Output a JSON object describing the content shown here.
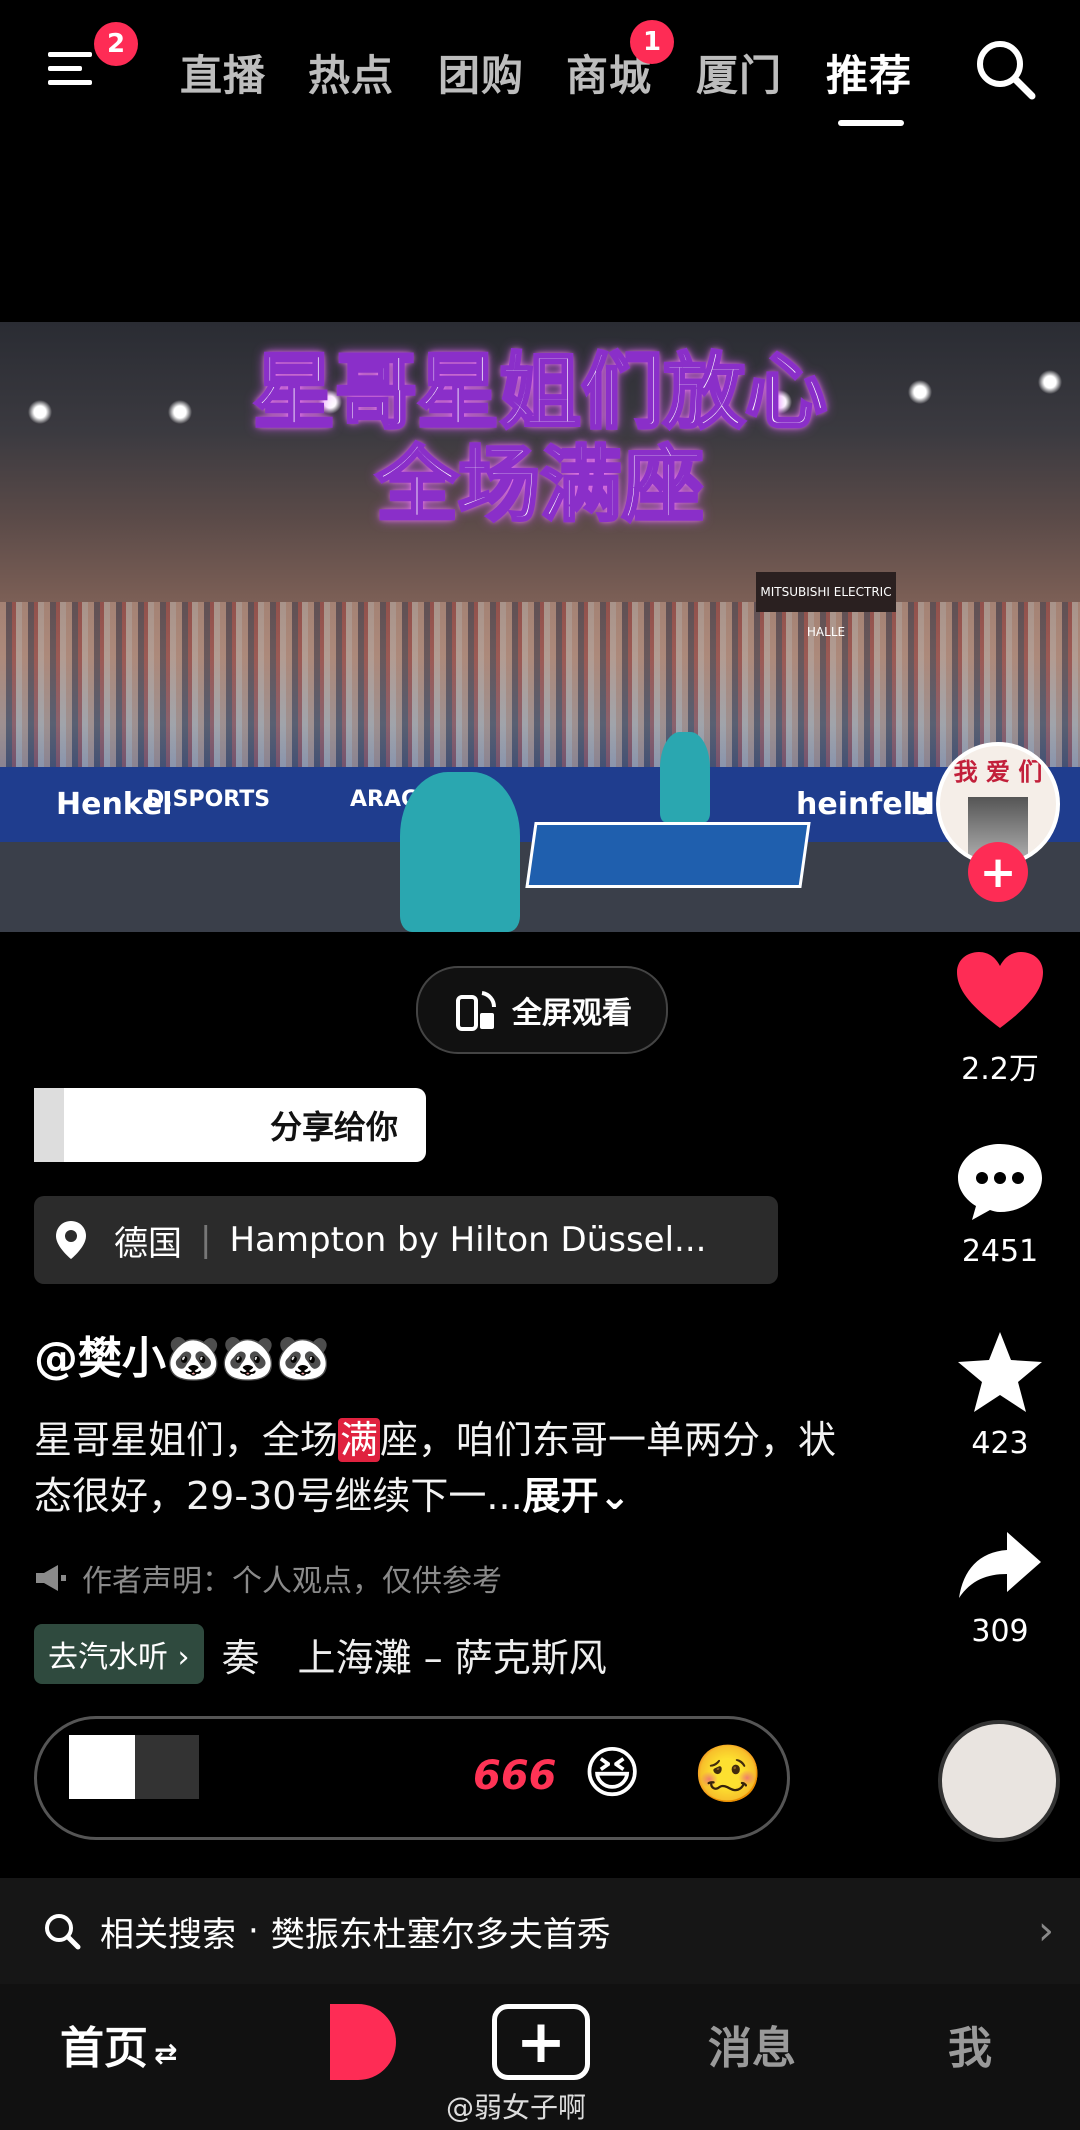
{
  "top_nav": {
    "menu_badge": "2",
    "tabs": [
      {
        "label": "直播"
      },
      {
        "label": "热点"
      },
      {
        "label": "团购"
      },
      {
        "label": "商城",
        "badge": "1"
      },
      {
        "label": "厦门"
      },
      {
        "label": "推荐",
        "active": true
      }
    ]
  },
  "video": {
    "caption_line1": "星哥星姐们放心",
    "caption_line2": "全场满座",
    "board_texts": [
      "Henkel",
      "D.SPORTS",
      "ARAG",
      "Henkel",
      "heinfels"
    ],
    "sign_text": "MITSUBISHI ELECTRIC HALLE",
    "creator_avatar_text": "我 爱 们"
  },
  "rail": {
    "likes": "2.2万",
    "comments": "2451",
    "favorites": "423",
    "shares": "309"
  },
  "fullscreen_label": "全屏观看",
  "share_label": "分享给你",
  "location": {
    "region": "德国",
    "place": "Hampton by Hilton Düssel..."
  },
  "author": "@樊小🐼🐼🐼",
  "description": {
    "part1": "星哥星姐们，全场",
    "highlight": "满",
    "part2": "座，咱们东哥一单两分，状态很好，29-30号继续下一...",
    "expand": "展开"
  },
  "declaration": "作者声明：个人观点，仅供参考",
  "music": {
    "button": "去汽水听",
    "title": "奏　上海灘 – 萨克斯风"
  },
  "comment_emojis": [
    "666",
    "😆",
    "🥴"
  ],
  "related_search": {
    "prefix": "相关搜索",
    "query": "樊振东杜塞尔多夫首秀"
  },
  "bottom_nav": {
    "home": "首页",
    "messages": "消息",
    "me": "我"
  },
  "watermark": "@弱女子啊",
  "colors": {
    "accent": "#fe2c55",
    "background": "#000000"
  }
}
